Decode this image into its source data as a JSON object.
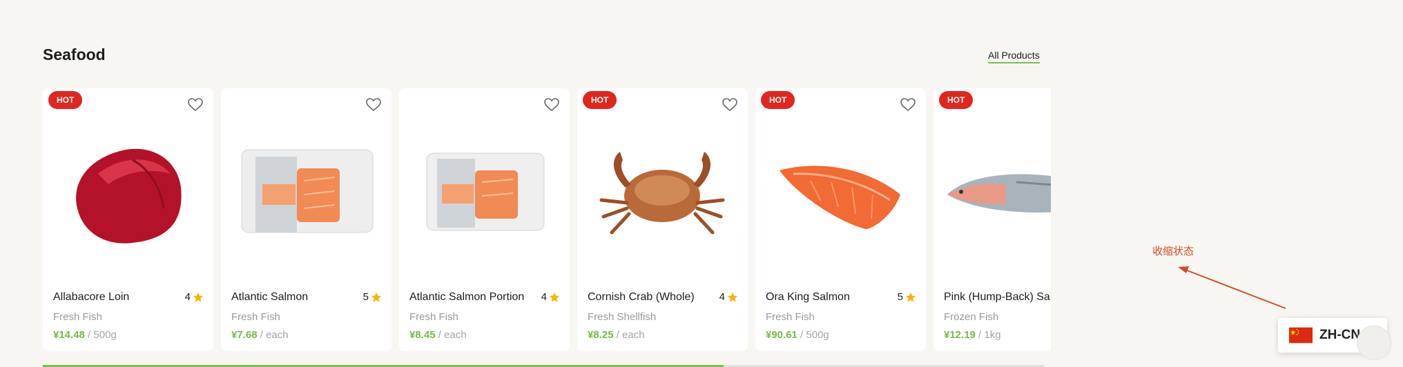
{
  "section": {
    "title": "Seafood",
    "link_label": "All Products"
  },
  "products": [
    {
      "name": "Allabacore Loin",
      "rating": "4",
      "category": "Fresh Fish",
      "price": "¥14.48",
      "unit": " / 500g",
      "hot": true,
      "badge": "HOT",
      "image_icon": "tuna-loin-image"
    },
    {
      "name": "Atlantic Salmon",
      "rating": "5",
      "category": "Fresh Fish",
      "price": "¥7.68",
      "unit": " / each",
      "hot": false,
      "badge": "",
      "image_icon": "salmon-pack-image"
    },
    {
      "name": "Atlantic Salmon Portion",
      "rating": "4",
      "category": "Fresh Fish",
      "price": "¥8.45",
      "unit": " / each",
      "hot": false,
      "badge": "",
      "image_icon": "salmon-portion-pack-image"
    },
    {
      "name": "Cornish Crab (Whole)",
      "rating": "4",
      "category": "Fresh Shellfish",
      "price": "¥8.25",
      "unit": " / each",
      "hot": true,
      "badge": "HOT",
      "image_icon": "crab-image"
    },
    {
      "name": "Ora King Salmon",
      "rating": "5",
      "category": "Fresh Fish",
      "price": "¥90.61",
      "unit": " / 500g",
      "hot": true,
      "badge": "HOT",
      "image_icon": "salmon-fillet-image"
    },
    {
      "name": "Pink (Hump-Back) Salmon",
      "rating": "",
      "category": "Frozen Fish",
      "price": "¥12.19",
      "unit": " / 1kg",
      "hot": true,
      "badge": "HOT",
      "image_icon": "whole-fish-image"
    }
  ],
  "scroll_progress": 0.68,
  "annotation": {
    "text": "收缩状态"
  },
  "language_switcher": {
    "label": "ZH-CN",
    "flag_icon": "china-flag-icon",
    "chevron_icon": "chevron-up-icon"
  },
  "colors": {
    "accent_green": "#7cbd57",
    "hot_badge": "#e0261e",
    "star": "#f2b705",
    "annotation": "#d84a26"
  }
}
